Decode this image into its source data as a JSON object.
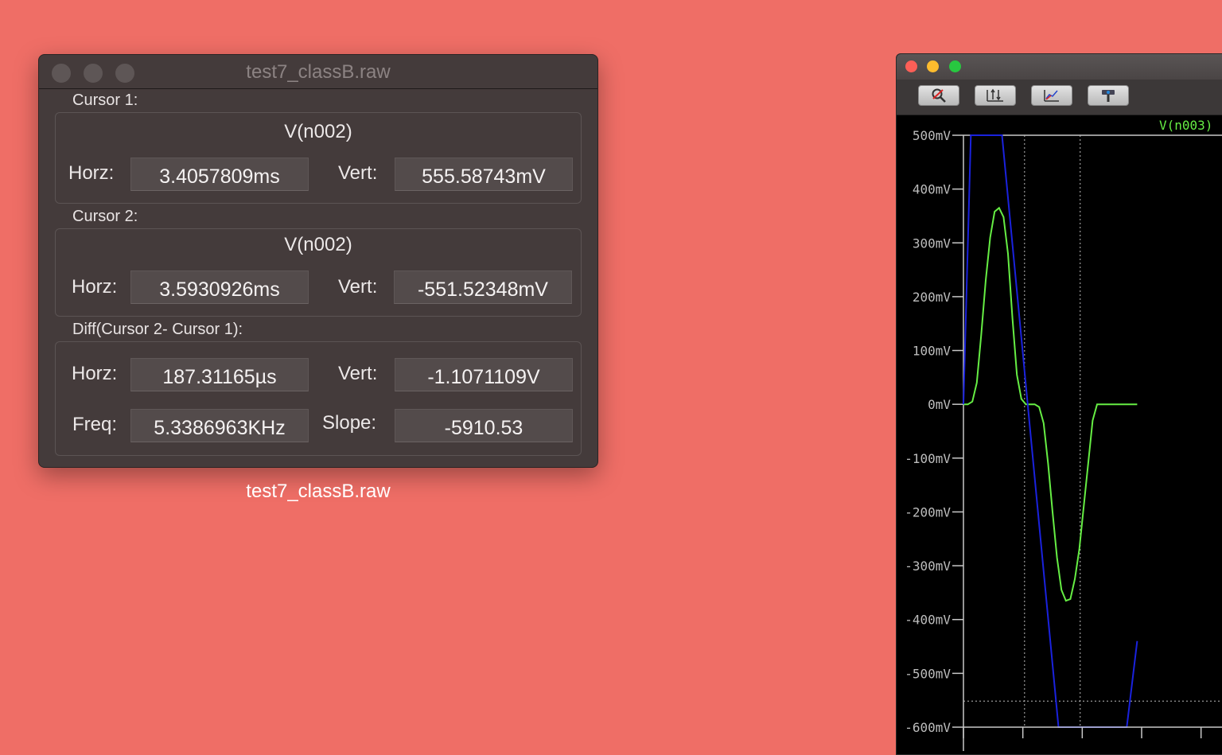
{
  "cursor_window": {
    "title": "test7_classB.raw",
    "caption": "test7_classB.raw",
    "cursor1": {
      "section_label": "Cursor 1:",
      "signal": "V(n002)",
      "horz_label": "Horz:",
      "horz_value": "3.4057809ms",
      "vert_label": "Vert:",
      "vert_value": "555.58743mV"
    },
    "cursor2": {
      "section_label": "Cursor 2:",
      "signal": "V(n002)",
      "horz_label": "Horz:",
      "horz_value": "3.5930926ms",
      "vert_label": "Vert:",
      "vert_value": "-551.52348mV"
    },
    "diff": {
      "section_label": "Diff(Cursor 2- Cursor 1):",
      "horz_label": "Horz:",
      "horz_value": "187.31165µs",
      "vert_label": "Vert:",
      "vert_value": "-1.1071109V",
      "freq_label": "Freq:",
      "freq_value": "5.3386963KHz",
      "slope_label": "Slope:",
      "slope_value": "-5910.53"
    }
  },
  "plot_window": {
    "toolbar_icons": [
      "zoom-icon",
      "autorange-icon",
      "plot-settings-icon",
      "pick-traces-icon"
    ],
    "trace_label": "V(n003)",
    "colors": {
      "background": "#000000",
      "v_n003": "#66ee44",
      "v_n002": "#1a22dd",
      "grid_axis": "#c8c8c8"
    },
    "y_ticks": [
      "500mV",
      "400mV",
      "300mV",
      "200mV",
      "100mV",
      "0mV",
      "-100mV",
      "-200mV",
      "-300mV",
      "-400mV",
      "-500mV",
      "-600mV"
    ]
  },
  "chart_data": {
    "type": "line",
    "y_unit": "mV",
    "ylim": [
      -600,
      500
    ],
    "x_unit": "ms",
    "xlim": [
      3.2,
      4.1
    ],
    "cursor_x": [
      3.4057809,
      3.5930926
    ],
    "cursor_y": -551.52348,
    "series": [
      {
        "name": "V(n003)",
        "color": "#66ee44",
        "x": [
          3.2,
          3.215,
          3.23,
          3.245,
          3.26,
          3.275,
          3.29,
          3.305,
          3.32,
          3.335,
          3.35,
          3.365,
          3.38,
          3.395,
          3.41,
          3.425,
          3.44,
          3.455,
          3.47,
          3.485,
          3.5,
          3.515,
          3.53,
          3.545,
          3.56,
          3.575,
          3.59,
          3.605,
          3.62,
          3.635,
          3.65,
          3.665,
          3.68,
          3.695,
          3.71,
          3.725,
          3.74,
          3.755,
          3.77,
          3.785
        ],
        "values": [
          0,
          0,
          5,
          40,
          130,
          230,
          310,
          358,
          365,
          348,
          280,
          160,
          55,
          10,
          0,
          0,
          0,
          -5,
          -35,
          -110,
          -200,
          -285,
          -345,
          -365,
          -362,
          -325,
          -270,
          -190,
          -110,
          -30,
          0,
          0,
          0,
          0,
          0,
          0,
          0,
          0,
          0,
          0
        ]
      },
      {
        "name": "V(n002)",
        "color": "#1a22dd",
        "x": [
          3.2,
          3.225,
          3.33,
          3.52,
          3.75,
          3.785
        ],
        "values": [
          0,
          500,
          500,
          -600,
          -600,
          -440
        ]
      }
    ]
  }
}
